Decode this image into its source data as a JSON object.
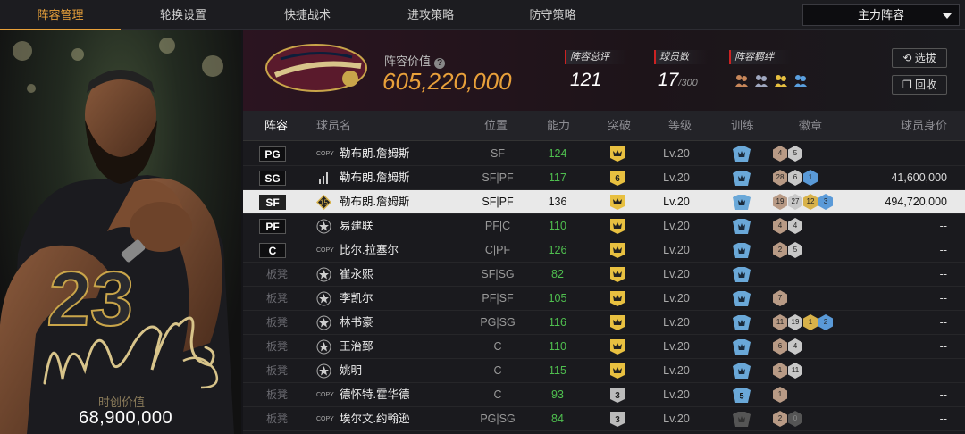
{
  "nav": {
    "tabs": [
      "阵容管理",
      "轮换设置",
      "快捷战术",
      "进攻策略",
      "防守策略"
    ],
    "lineup_select": "主力阵容"
  },
  "portrait": {
    "market_label": "时创价值",
    "market_value": "68,900,000",
    "jersey": "23"
  },
  "summary": {
    "value_label": "阵容价值",
    "value": "605,220,000",
    "rating_label": "阵容总评",
    "rating": "121",
    "count_label": "球员数",
    "count": "17",
    "count_max": "/300",
    "bond_label": "阵容羁绊",
    "btn_select": "选拔",
    "btn_recycle": "回收",
    "colors": {
      "accent": "#e8a03a",
      "ability": "#4fbf4f",
      "bond": "#e8a03a"
    }
  },
  "table": {
    "headers": [
      "阵容",
      "球员名",
      "位置",
      "能力",
      "突破",
      "等级",
      "训练",
      "徽章",
      "球员身价"
    ],
    "rows": [
      {
        "slot": "PG",
        "bench": false,
        "type": "copy",
        "name": "勒布朗.詹姆斯",
        "pos": "SF",
        "ability": "124",
        "breakthrough": "crown",
        "level": "Lv.20",
        "train": "crown",
        "badges": [
          {
            "t": "bronze",
            "v": "4"
          },
          {
            "t": "silver",
            "v": "5"
          }
        ],
        "value": "--"
      },
      {
        "slot": "SG",
        "bench": false,
        "type": "bars",
        "name": "勒布朗.詹姆斯",
        "pos": "SF|PF",
        "ability": "117",
        "breakthrough": "6",
        "level": "Lv.20",
        "train": "crown",
        "badges": [
          {
            "t": "bronze",
            "v": "28"
          },
          {
            "t": "silver",
            "v": "6"
          },
          {
            "t": "blue",
            "v": "1"
          }
        ],
        "value": "41,600,000"
      },
      {
        "slot": "SF",
        "bench": false,
        "type": "15",
        "name": "勒布朗.詹姆斯",
        "pos": "SF|PF",
        "ability": "136",
        "breakthrough": "crown",
        "level": "Lv.20",
        "train": "crown",
        "badges": [
          {
            "t": "bronze",
            "v": "19"
          },
          {
            "t": "silver",
            "v": "27"
          },
          {
            "t": "gold",
            "v": "12"
          },
          {
            "t": "blue",
            "v": "3"
          }
        ],
        "value": "494,720,000",
        "highlight": true
      },
      {
        "slot": "PF",
        "bench": false,
        "type": "star",
        "name": "易建联",
        "pos": "PF|C",
        "ability": "110",
        "breakthrough": "crown",
        "level": "Lv.20",
        "train": "crown",
        "badges": [
          {
            "t": "bronze",
            "v": "4"
          },
          {
            "t": "silver",
            "v": "4"
          }
        ],
        "value": "--"
      },
      {
        "slot": "C",
        "bench": false,
        "type": "copy",
        "name": "比尔.拉塞尔",
        "pos": "C|PF",
        "ability": "126",
        "breakthrough": "crown",
        "level": "Lv.20",
        "train": "crown",
        "badges": [
          {
            "t": "bronze",
            "v": "2"
          },
          {
            "t": "silver",
            "v": "5"
          }
        ],
        "value": "--"
      },
      {
        "slot": "板凳",
        "bench": true,
        "type": "star",
        "name": "崔永熙",
        "pos": "SF|SG",
        "ability": "82",
        "breakthrough": "crown",
        "level": "Lv.20",
        "train": "crown",
        "badges": [],
        "value": "--"
      },
      {
        "slot": "板凳",
        "bench": true,
        "type": "star",
        "name": "李凯尔",
        "pos": "PF|SF",
        "ability": "105",
        "breakthrough": "crown",
        "level": "Lv.20",
        "train": "crown",
        "badges": [
          {
            "t": "bronze",
            "v": "7"
          }
        ],
        "value": "--"
      },
      {
        "slot": "板凳",
        "bench": true,
        "type": "star",
        "name": "林书豪",
        "pos": "PG|SG",
        "ability": "116",
        "breakthrough": "crown",
        "level": "Lv.20",
        "train": "crown",
        "badges": [
          {
            "t": "bronze",
            "v": "11"
          },
          {
            "t": "silver",
            "v": "19"
          },
          {
            "t": "gold",
            "v": "1"
          },
          {
            "t": "blue",
            "v": "2"
          }
        ],
        "value": "--"
      },
      {
        "slot": "板凳",
        "bench": true,
        "type": "star",
        "name": "王治郅",
        "pos": "C",
        "ability": "110",
        "breakthrough": "crown",
        "level": "Lv.20",
        "train": "crown",
        "badges": [
          {
            "t": "bronze",
            "v": "6"
          },
          {
            "t": "silver",
            "v": "4"
          }
        ],
        "value": "--"
      },
      {
        "slot": "板凳",
        "bench": true,
        "type": "star",
        "name": "姚明",
        "pos": "C",
        "ability": "115",
        "breakthrough": "crown",
        "level": "Lv.20",
        "train": "crown",
        "badges": [
          {
            "t": "bronze",
            "v": "1"
          },
          {
            "t": "silver",
            "v": "11"
          }
        ],
        "value": "--"
      },
      {
        "slot": "板凳",
        "bench": true,
        "type": "copy",
        "name": "德怀特.霍华德",
        "pos": "C",
        "ability": "93",
        "breakthrough": "3",
        "level": "Lv.20",
        "train": "5",
        "badges": [
          {
            "t": "bronze",
            "v": "1"
          }
        ],
        "value": "--"
      },
      {
        "slot": "板凳",
        "bench": true,
        "type": "copy",
        "name": "埃尔文.约翰逊",
        "pos": "PG|SG",
        "ability": "84",
        "breakthrough": "3",
        "level": "Lv.20",
        "train": "empty",
        "badges": [
          {
            "t": "bronze",
            "v": "2"
          },
          {
            "t": "dark",
            "v": "0"
          }
        ],
        "value": "--"
      }
    ]
  }
}
